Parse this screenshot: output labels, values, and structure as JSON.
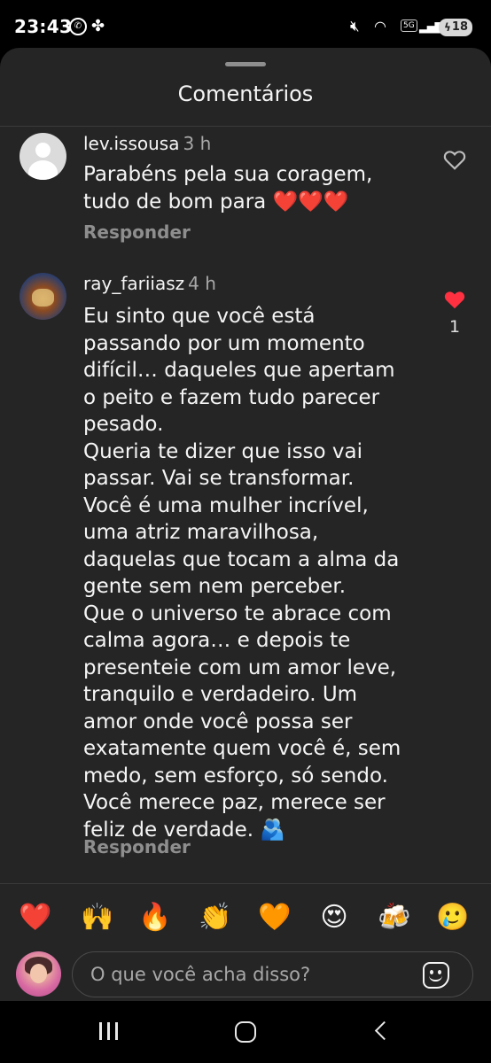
{
  "status_bar": {
    "time": "23:43",
    "battery": "18",
    "network": "5G"
  },
  "sheet": {
    "title": "Comentários"
  },
  "comments": [
    {
      "username": "lev.issousa",
      "time": "3 h",
      "text": "Parabéns pela sua coragem,\ntudo de bom para ❤️❤️❤️",
      "reply_label": "Responder",
      "liked": false,
      "like_count": ""
    },
    {
      "username": "ray_fariiasz",
      "time": "4 h",
      "text": "Eu sinto que você está\npassando por um momento\ndifícil… daqueles que apertam\no peito e fazem tudo parecer\npesado.\nQueria te dizer que isso vai\npassar. Vai se transformar.\nVocê é uma mulher incrível,\numa atriz maravilhosa,\ndaquelas que tocam a alma da\ngente sem nem perceber.\nQue o universo te abrace com\ncalma agora… e depois te\npresenteie com um amor leve,\ntranquilo e verdadeiro. Um\namor onde você possa ser\nexatamente quem você é, sem\nmedo, sem esforço, só sendo.\nVocê merece paz, merece ser\nfeliz de verdade. 🫂",
      "reply_label": "Responder",
      "liked": true,
      "like_count": "1"
    }
  ],
  "reactions": [
    "❤️",
    "🙌",
    "🔥",
    "👏",
    "🧡",
    "😍",
    "🍻",
    "🥲"
  ],
  "composer": {
    "placeholder": "O que você acha disso?"
  },
  "colors": {
    "sheet_bg": "#252526",
    "like_red": "#ff3040",
    "muted_text": "#8e8e8e"
  },
  "icons": {
    "like_outline": "heart-outline-icon",
    "like_filled": "heart-filled-icon",
    "sticker": "sticker-icon"
  }
}
